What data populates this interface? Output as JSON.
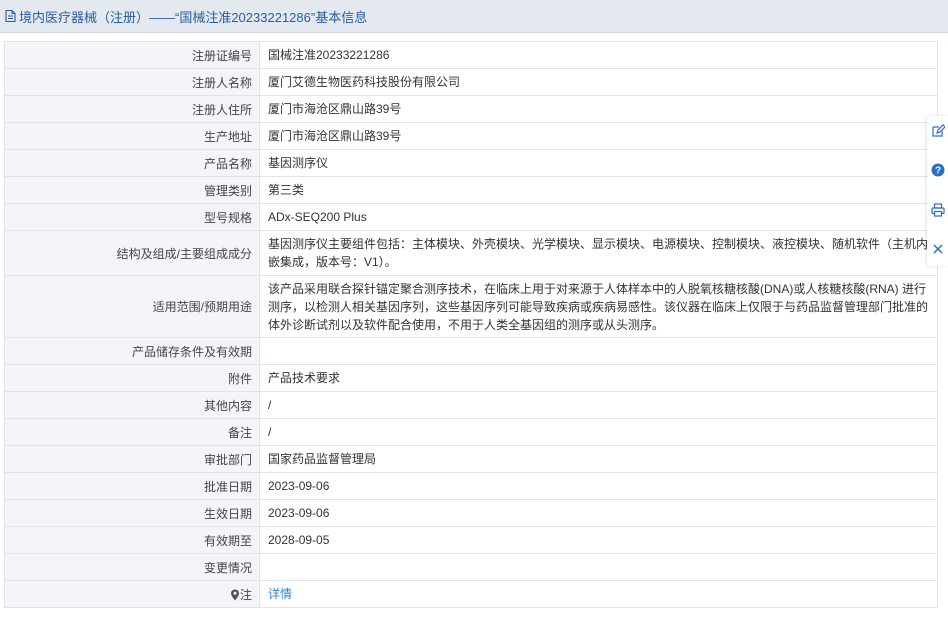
{
  "header": {
    "title": "境内医疗器械（注册）——“国械注准20233221286”基本信息"
  },
  "rows": [
    {
      "label": "注册证编号",
      "value": "国械注准20233221286"
    },
    {
      "label": "注册人名称",
      "value": "厦门艾德生物医药科技股份有限公司"
    },
    {
      "label": "注册人住所",
      "value": "厦门市海沧区鼎山路39号"
    },
    {
      "label": "生产地址",
      "value": "厦门市海沧区鼎山路39号"
    },
    {
      "label": "产品名称",
      "value": "基因测序仪"
    },
    {
      "label": "管理类别",
      "value": "第三类"
    },
    {
      "label": "型号规格",
      "value": "ADx-SEQ200 Plus"
    },
    {
      "label": "结构及组成/主要组成成分",
      "value": "基因测序仪主要组件包括：主体模块、外壳模块、光学模块、显示模块、电源模块、控制模块、液控模块、随机软件（主机内嵌集成，版本号：V1）。"
    },
    {
      "label": "适用范围/预期用途",
      "value": "该产品采用联合探针锚定聚合测序技术，在临床上用于对来源于人体样本中的人脱氧核糖核酸(DNA)或人核糖核酸(RNA) 进行测序，以检测人相关基因序列，这些基因序列可能导致疾病或疾病易感性。该仪器在临床上仅限于与药品监督管理部门批准的体外诊断试剂以及软件配合使用，不用于人类全基因组的测序或从头测序。"
    },
    {
      "label": "产品储存条件及有效期",
      "value": ""
    },
    {
      "label": "附件",
      "value": "产品技术要求"
    },
    {
      "label": "其他内容",
      "value": "/"
    },
    {
      "label": "备注",
      "value": "/"
    },
    {
      "label": "审批部门",
      "value": "国家药品监督管理局"
    },
    {
      "label": "批准日期",
      "value": "2023-09-06"
    },
    {
      "label": "生效日期",
      "value": "2023-09-06"
    },
    {
      "label": "有效期至",
      "value": "2028-09-05"
    },
    {
      "label": "变更情况",
      "value": ""
    }
  ],
  "note_row": {
    "label": "注",
    "link": "详情"
  },
  "colors": {
    "title_text": "#2a5d9f",
    "header_bg": "#e4e8ef",
    "label_bg": "#f3f5f8",
    "border": "#e0e3e8",
    "link": "#3b7fc4",
    "toolbar_icon": "#2a6fc7"
  },
  "toolbar": {
    "icons": [
      "edit-icon",
      "help-icon",
      "print-icon",
      "close-icon"
    ]
  }
}
